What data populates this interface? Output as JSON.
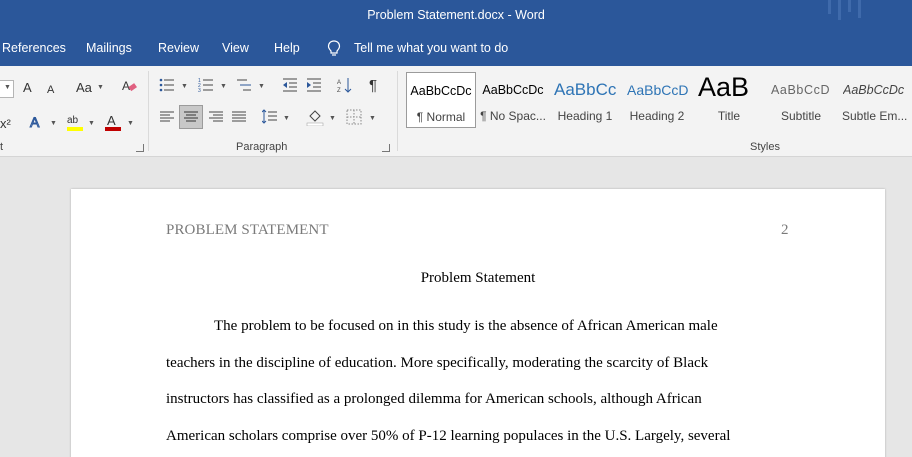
{
  "titlebar": {
    "title": "Problem Statement.docx  -  Word"
  },
  "menu": {
    "items": [
      "References",
      "Mailings",
      "Review",
      "View",
      "Help"
    ],
    "tell_me": "Tell me what you want to do"
  },
  "ribbon": {
    "groups": {
      "font_partial": "t",
      "paragraph": "Paragraph",
      "styles": "Styles"
    },
    "styles": [
      {
        "sample": "AaBbCcDc",
        "name": "¶ Normal"
      },
      {
        "sample": "AaBbCcDc",
        "name": "¶ No Spac..."
      },
      {
        "sample": "AaBbCc",
        "name": "Heading 1"
      },
      {
        "sample": "AaBbCcD",
        "name": "Heading 2"
      },
      {
        "sample": "AaB",
        "name": "Title"
      },
      {
        "sample": "AaBbCcD",
        "name": "Subtitle"
      },
      {
        "sample": "AaBbCcDc",
        "name": "Subtle Em..."
      }
    ],
    "font_size_glyphs": {
      "grow": "A",
      "shrink": "A",
      "case": "Aa",
      "superscript": "x²"
    },
    "pilcrow": "¶",
    "colors": {
      "highlight": "#ffff00",
      "font_color": "#c00000",
      "selected_bg": "#c8c8c8"
    }
  },
  "document": {
    "running_head": "PROBLEM STATEMENT",
    "page_number": "2",
    "title": "Problem Statement",
    "lines": [
      "The problem to be focused on in this study is the absence of African American male",
      "teachers in the discipline of education. More specifically, moderating the scarcity of Black",
      "instructors has classified as a prolonged dilemma for American schools, although African",
      "American scholars comprise over 50% of P-12 learning populaces in the U.S. Largely, several"
    ]
  }
}
